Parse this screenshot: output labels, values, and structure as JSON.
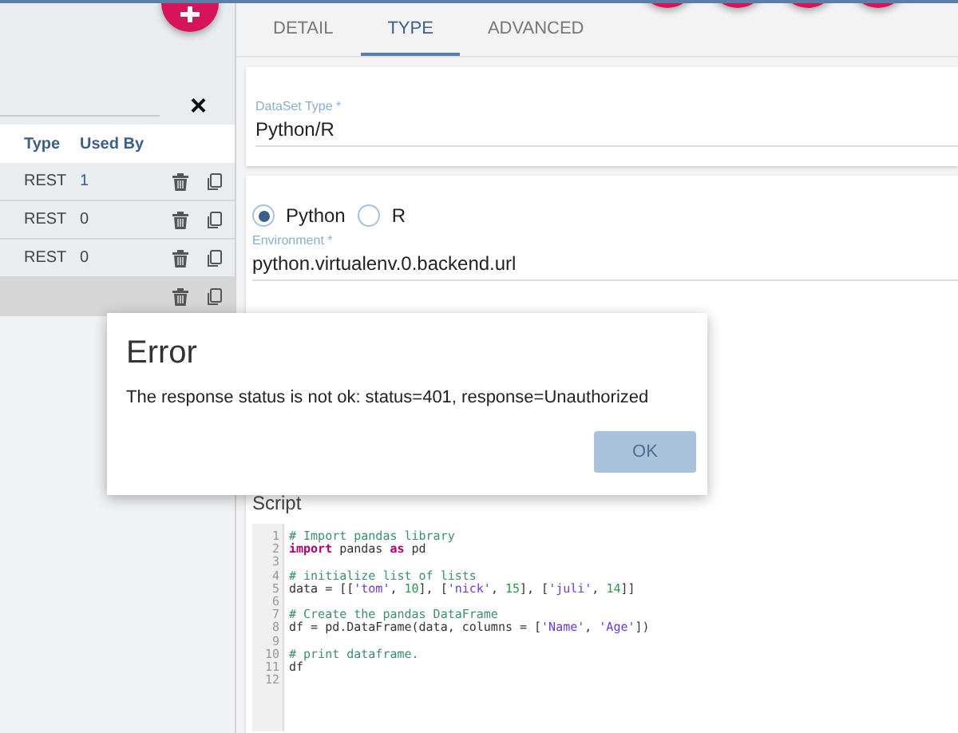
{
  "left_panel": {
    "close_button": "×",
    "table": {
      "columns": [
        "Type",
        "Used By"
      ],
      "rows": [
        {
          "type": "REST",
          "used_by": "1",
          "selected": false
        },
        {
          "type": "REST",
          "used_by": "0",
          "selected": false
        },
        {
          "type": "REST",
          "used_by": "0",
          "selected": false
        },
        {
          "selected": true
        }
      ]
    }
  },
  "tabs": [
    {
      "label": "DETAIL",
      "selected": false
    },
    {
      "label": "TYPE",
      "selected": true
    },
    {
      "label": "ADVANCED",
      "selected": false
    }
  ],
  "dataset_type": {
    "label": "DataSet Type *",
    "value": "Python/R"
  },
  "language": [
    {
      "label": "Python",
      "selected": true
    },
    {
      "label": "R",
      "selected": false
    }
  ],
  "environment": {
    "label": "Environment *",
    "value": "python.virtualenv.0.backend.url"
  },
  "script": {
    "label": "Script",
    "lines": [
      {
        "number": "1",
        "tokens": [
          {
            "kind": "comment",
            "text": "# Import pandas library"
          }
        ]
      },
      {
        "number": "2",
        "tokens": [
          {
            "kind": "keyword",
            "text": "import"
          },
          {
            "kind": "plain",
            "text": " pandas "
          },
          {
            "kind": "keyword",
            "text": "as"
          },
          {
            "kind": "plain",
            "text": " pd"
          }
        ]
      },
      {
        "number": "3"
      },
      {
        "number": "4",
        "tokens": [
          {
            "kind": "comment",
            "text": "# initialize list of lists"
          }
        ]
      },
      {
        "number": "5",
        "tokens": [
          {
            "kind": "plain",
            "text": "data = [["
          },
          {
            "kind": "string",
            "text": "'tom'"
          },
          {
            "kind": "plain",
            "text": ", "
          },
          {
            "kind": "number",
            "text": "10"
          },
          {
            "kind": "plain",
            "text": "], ["
          },
          {
            "kind": "string",
            "text": "'nick'"
          },
          {
            "kind": "plain",
            "text": ", "
          },
          {
            "kind": "number",
            "text": "15"
          },
          {
            "kind": "plain",
            "text": "], ["
          },
          {
            "kind": "string",
            "text": "'juli'"
          },
          {
            "kind": "plain",
            "text": ", "
          },
          {
            "kind": "number",
            "text": "14"
          },
          {
            "kind": "plain",
            "text": "]]"
          }
        ]
      },
      {
        "number": "6"
      },
      {
        "number": "7",
        "tokens": [
          {
            "kind": "comment",
            "text": "# Create the pandas DataFrame"
          }
        ]
      },
      {
        "number": "8",
        "tokens": [
          {
            "kind": "plain",
            "text": "df = pd.DataFrame(data, columns = ["
          },
          {
            "kind": "string",
            "text": "'Name'"
          },
          {
            "kind": "plain",
            "text": ", "
          },
          {
            "kind": "string",
            "text": "'Age'"
          },
          {
            "kind": "plain",
            "text": "])"
          }
        ]
      },
      {
        "number": "9"
      },
      {
        "number": "10",
        "tokens": [
          {
            "kind": "comment",
            "text": "# print dataframe."
          }
        ]
      },
      {
        "number": "11",
        "tokens": [
          {
            "kind": "plain",
            "text": "df"
          }
        ]
      },
      {
        "number": "12"
      }
    ]
  },
  "dialog": {
    "title": "Error",
    "message": "The response status is not ok: status=401, response=Unauthorized",
    "button": "OK"
  }
}
